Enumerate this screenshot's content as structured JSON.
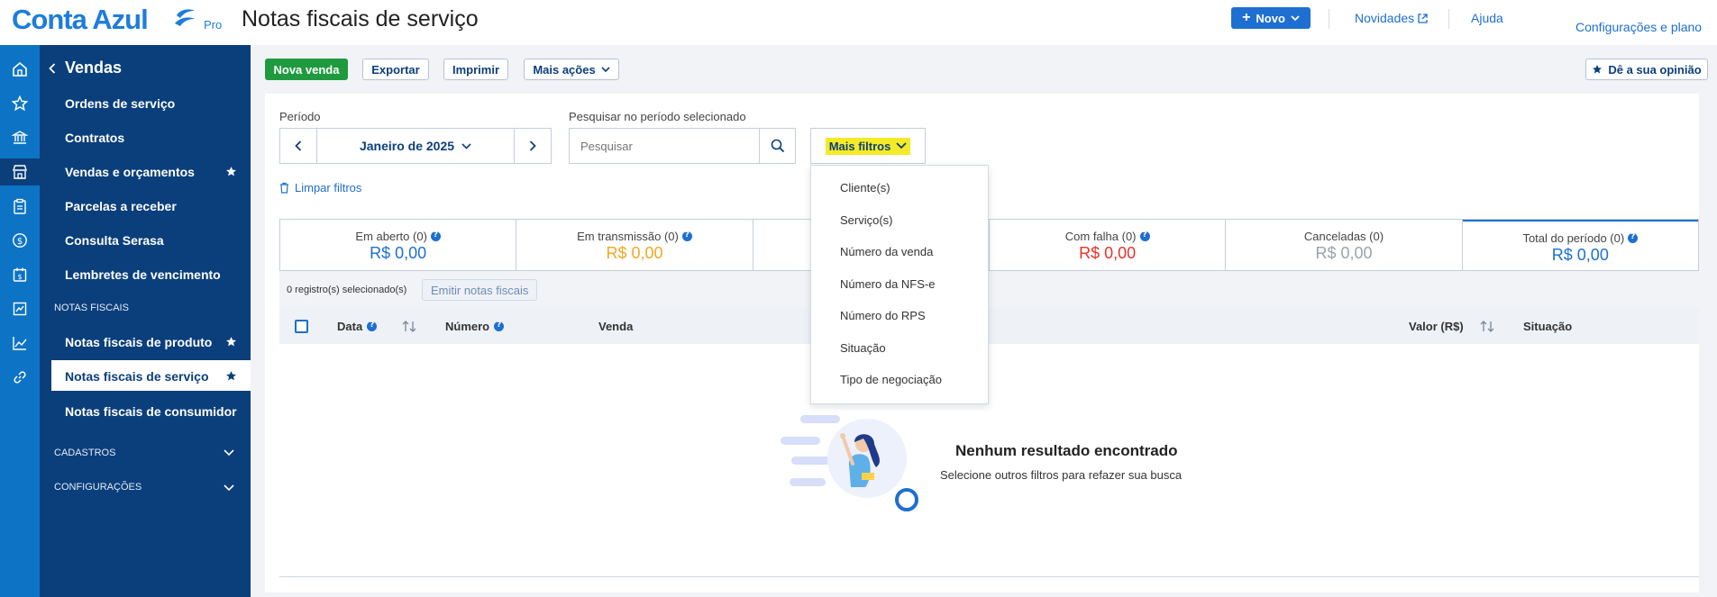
{
  "brand": {
    "name": "Conta Azul",
    "tier": "Pro"
  },
  "header": {
    "title": "Notas fiscais de serviço",
    "new_button": "Novo",
    "links": {
      "news": "Novidades",
      "help": "Ajuda",
      "settings": "Configurações e plano"
    }
  },
  "sidebar": {
    "back_title": "Vendas",
    "items": [
      "Ordens de serviço",
      "Contratos",
      "Vendas e orçamentos",
      "Parcelas a receber",
      "Consulta Serasa",
      "Lembretes de vencimento"
    ],
    "section_fiscal": "NOTAS FISCAIS",
    "fiscal_items": [
      "Notas fiscais de produto",
      "Notas fiscais de serviço",
      "Notas fiscais de consumidor"
    ],
    "section_cadastros": "CADASTROS",
    "section_config": "CONFIGURAÇÕES"
  },
  "toolbar": {
    "new_sale": "Nova venda",
    "export": "Exportar",
    "print": "Imprimir",
    "more_actions": "Mais ações",
    "feedback": "Dê a sua opinião"
  },
  "filters": {
    "period_label": "Período",
    "period_value": "Janeiro de 2025",
    "search_label": "Pesquisar no período selecionado",
    "search_placeholder": "Pesquisar",
    "more_filters": "Mais filtros",
    "clear": "Limpar filtros",
    "dropdown": [
      "Cliente(s)",
      "Serviço(s)",
      "Número da venda",
      "Número da NFS-e",
      "Número do RPS",
      "Situação",
      "Tipo de negociação"
    ]
  },
  "stats": [
    {
      "label": "Em aberto (0)",
      "value": "R$ 0,00",
      "color": "#1d6fd1",
      "help": true
    },
    {
      "label": "Em transmissão (0)",
      "value": "R$ 0,00",
      "color": "#f5a623",
      "help": true
    },
    {
      "label": "",
      "value": "",
      "color": "#222222",
      "help": false
    },
    {
      "label": "Com falha (0)",
      "value": "R$ 0,00",
      "color": "#e8322a",
      "help": true
    },
    {
      "label": "Canceladas (0)",
      "value": "R$ 0,00",
      "color": "#9aa3ad",
      "help": false
    },
    {
      "label": "Total do período (0)",
      "value": "R$ 0,00",
      "color": "#1d6fd1",
      "help": true
    }
  ],
  "table": {
    "selected_count": "0 registro(s) selecionado(s)",
    "emit_button": "Emitir notas fiscais",
    "columns": {
      "date": "Data",
      "number": "Número",
      "sale": "Venda",
      "value": "Valor (R$)",
      "status": "Situação"
    }
  },
  "empty": {
    "title": "Nenhum resultado encontrado",
    "subtitle": "Selecione outros filtros para refazer sua busca"
  }
}
